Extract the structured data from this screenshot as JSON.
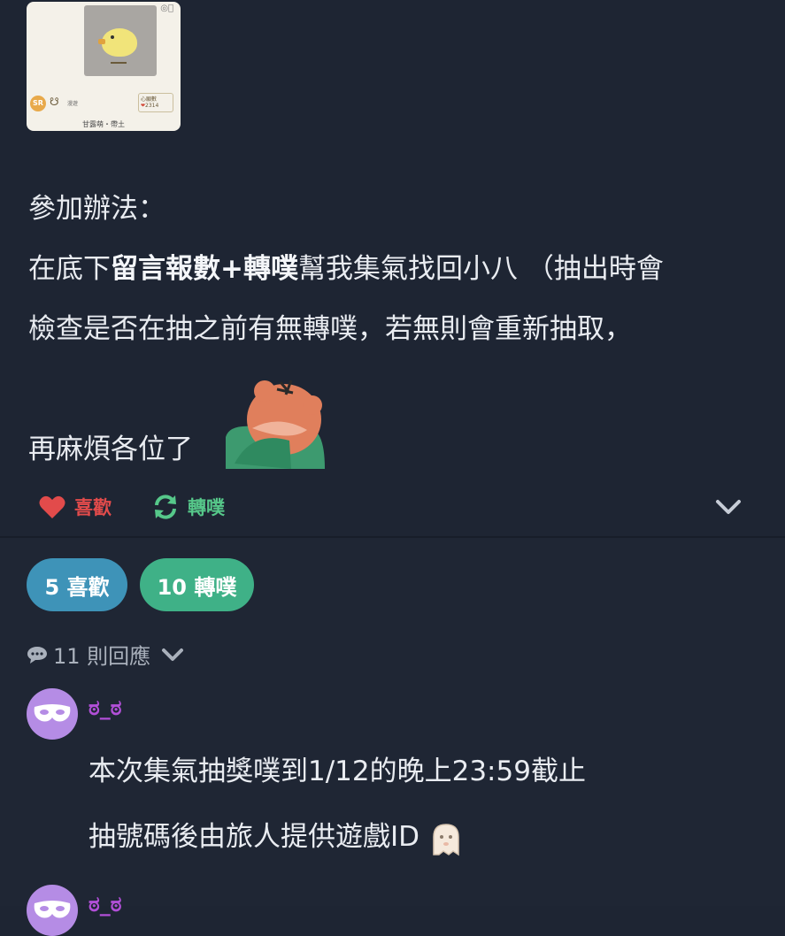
{
  "card": {
    "rarity_badge": "SR",
    "mini_label": "漫遊",
    "stat_label": "心願數",
    "stat_value": "2314",
    "name": "甘露萌・帶土"
  },
  "post": {
    "lines": [
      {
        "segments": [
          {
            "text": "參加辦法：",
            "bold": false
          }
        ]
      },
      {
        "segments": [
          {
            "text": "在底下",
            "bold": false
          },
          {
            "text": "留言報數+轉噗",
            "bold": true
          },
          {
            "text": "幫我集氣找回小八 （抽出時會",
            "bold": false
          }
        ]
      },
      {
        "segments": [
          {
            "text": "檢查是否在抽之前有無轉噗，若無則會重新抽取，",
            "bold": false
          }
        ]
      },
      {
        "segments": [
          {
            "text": "再麻煩各位了",
            "bold": false
          }
        ]
      }
    ]
  },
  "actions": {
    "like_label": "喜歡",
    "replurk_label": "轉噗"
  },
  "stats": {
    "likes_pill": "5 喜歡",
    "replurks_pill": "10 轉噗"
  },
  "responses": {
    "label": "11 則回應"
  },
  "comments": [
    {
      "username": "ಠ_ಠ",
      "lines": [
        "本次集氣抽獎噗到1/12的晚上23:59截止",
        "抽號碼後由旅人提供遊戲ID"
      ]
    },
    {
      "username": "ಠ_ಠ",
      "lines": []
    }
  ],
  "colors": {
    "background": "#1e2533",
    "like_red": "#e24b4b",
    "replurk_green": "#56c88a",
    "likes_pill_blue": "#3e93b8",
    "replurks_pill_green": "#3fb187",
    "username_purple": "#b24fd8",
    "avatar_purple": "#b58ce5"
  },
  "icons": {
    "like": "heart-icon",
    "replurk": "refresh-icon",
    "expand": "chevron-down-icon",
    "responses": "speech-bubble-icon",
    "avatar": "mask-icon",
    "ghost": "ghost-emoji-icon"
  }
}
